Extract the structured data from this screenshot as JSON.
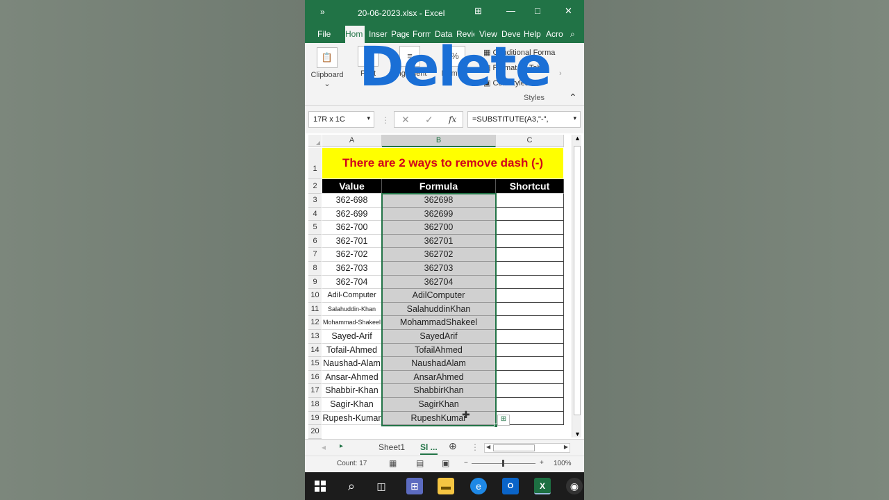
{
  "window": {
    "file_name": "20-06-2023.xlsx",
    "separator": "-",
    "app": "Excel",
    "title": "20-06-2023.xlsx  -  Excel"
  },
  "ribbon": {
    "tabs": [
      "File",
      "Hom",
      "Inser",
      "Page",
      "Form",
      "Data",
      "Revie",
      "View",
      "Deve",
      "Help",
      "Acro"
    ],
    "active_tab": "Hom",
    "groups": {
      "clipboard": "Clipboard",
      "font": "Font",
      "alignment": "Alignment",
      "number": "Number",
      "styles": "Styles"
    },
    "styles_items": [
      "Conditional Forma",
      "Format as Table",
      "Cell Styles"
    ]
  },
  "overlay_text": "Delete",
  "formula_bar": {
    "name_box": "17R x 1C",
    "fx_label": "fx",
    "formula": "=SUBSTITUTE(A3,\"-\","
  },
  "sheet": {
    "columns": [
      "A",
      "B",
      "C"
    ],
    "title": "There are 2 ways to remove dash (-)",
    "headers": [
      "Value",
      "Formula",
      "Shortcut"
    ],
    "row_numbers": [
      "1",
      "2",
      "3",
      "4",
      "5",
      "6",
      "7",
      "8",
      "9",
      "10",
      "11",
      "12",
      "13",
      "14",
      "15",
      "16",
      "17",
      "18",
      "19",
      "20"
    ],
    "rows": [
      {
        "value": "362-698",
        "formula": "362698"
      },
      {
        "value": "362-699",
        "formula": "362699"
      },
      {
        "value": "362-700",
        "formula": "362700"
      },
      {
        "value": "362-701",
        "formula": "362701"
      },
      {
        "value": "362-702",
        "formula": "362702"
      },
      {
        "value": "362-703",
        "formula": "362703"
      },
      {
        "value": "362-704",
        "formula": "362704"
      },
      {
        "value": "Adil-Computer",
        "formula": "AdilComputer"
      },
      {
        "value": "Salahuddin-Khan",
        "formula": "SalahuddinKhan"
      },
      {
        "value": "Mohammad-Shakeel",
        "formula": "MohammadShakeel"
      },
      {
        "value": "Sayed-Arif",
        "formula": "SayedArif"
      },
      {
        "value": "Tofail-Ahmed",
        "formula": "TofailAhmed"
      },
      {
        "value": "Naushad-Alam",
        "formula": "NaushadAlam"
      },
      {
        "value": "Ansar-Ahmed",
        "formula": "AnsarAhmed"
      },
      {
        "value": "Shabbir-Khan",
        "formula": "ShabbirKhan"
      },
      {
        "value": "Sagir-Khan",
        "formula": "SagirKhan"
      },
      {
        "value": "Rupesh-Kumar",
        "formula": "RupeshKumar"
      }
    ]
  },
  "sheet_tabs": [
    "Sheet1",
    "Sl ..."
  ],
  "status": {
    "count": "Count: 17",
    "zoom": "100%"
  },
  "colors": {
    "excel_green": "#217346",
    "title_fill": "#ffff00",
    "title_text": "#d0021b",
    "overlay": "#1a6fd6"
  }
}
